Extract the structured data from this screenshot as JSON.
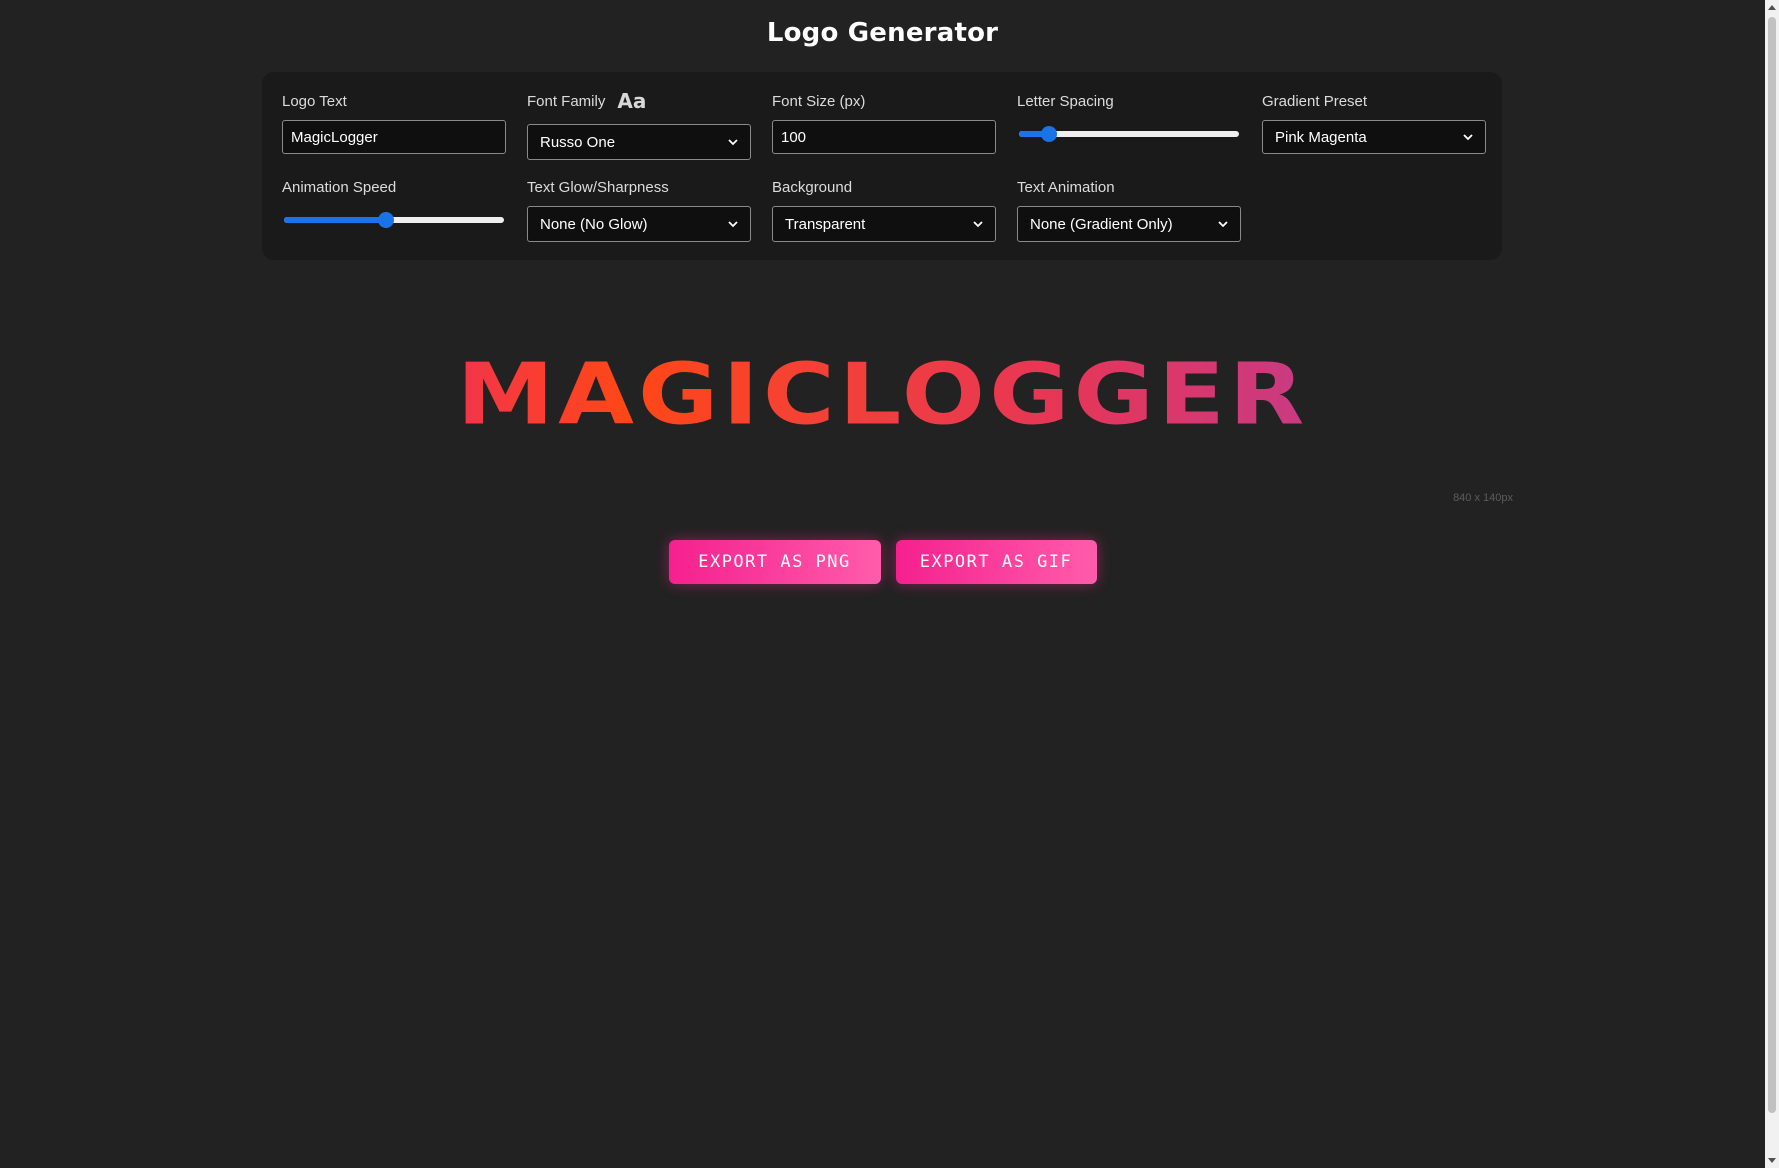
{
  "header": {
    "title": "Logo Generator"
  },
  "controls": {
    "logo_text": {
      "label": "Logo Text",
      "value": "MagicLogger"
    },
    "font_family": {
      "label": "Font Family",
      "icon_glyph": "Aa",
      "selected": "Russo One"
    },
    "font_size": {
      "label": "Font Size (px)",
      "value": "100"
    },
    "letter_spacing": {
      "label": "Letter Spacing",
      "value_fraction": 0.11
    },
    "gradient_preset": {
      "label": "Gradient Preset",
      "selected": "Pink Magenta"
    },
    "animation_speed": {
      "label": "Animation Speed",
      "value_fraction": 0.46
    },
    "text_glow": {
      "label": "Text Glow/Sharpness",
      "selected": "None (No Glow)"
    },
    "background": {
      "label": "Background",
      "selected": "Transparent"
    },
    "text_animation": {
      "label": "Text Animation",
      "selected": "None (Gradient Only)"
    }
  },
  "preview": {
    "text": "MagicLogger",
    "dimensions": "840 x 140px"
  },
  "actions": {
    "export_png": "Export as PNG",
    "export_gif": "Export as GIF"
  },
  "colors": {
    "page_background": "#222222",
    "panel_background": "#1a1a1a",
    "accent_blue": "#1a73e8",
    "button_pink_start": "#f5208e",
    "button_pink_end": "#ff5cab"
  }
}
